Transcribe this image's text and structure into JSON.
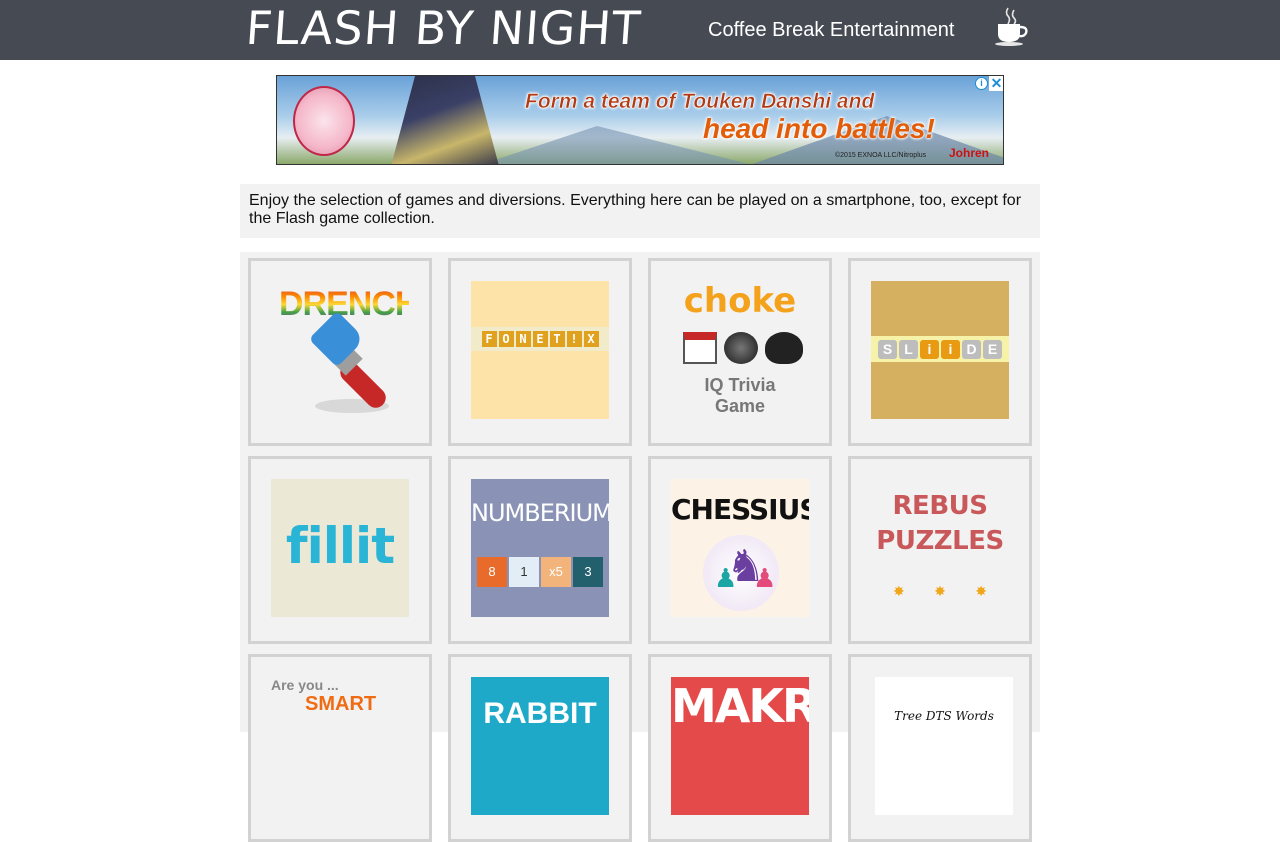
{
  "header": {
    "logo": "FLASH BY NIGHT",
    "tagline": "Coffee Break Entertainment",
    "cup_icon": "coffee-cup-icon"
  },
  "ad": {
    "line1": "Form a team of Touken Danshi and",
    "line2": "head into battles!",
    "copyright": "©2015 EXNOA LLC/Nitroplus",
    "brand": "Johren",
    "info_icon": "ad-info-icon",
    "close_icon": "ad-close-icon",
    "info_glyph": "i",
    "close_glyph": "✕"
  },
  "intro": {
    "text": "Enjoy the selection of games and diversions. Everything here can be played on a smartphone, too, except for the Flash game collection."
  },
  "games": {
    "drench": {
      "title": "DRENCH"
    },
    "fonetix": {
      "letters": [
        "F",
        "O",
        "N",
        "E",
        "T",
        "!",
        "X"
      ]
    },
    "choke": {
      "title": "choke",
      "sub1": "IQ Trivia",
      "sub2": "Game"
    },
    "slide": {
      "letters": [
        "S",
        "L",
        "i",
        "i",
        "D",
        "E"
      ]
    },
    "fillit": {
      "title": "fillit"
    },
    "numberium": {
      "title": "NUMBERIUM",
      "cells": [
        {
          "v": "8",
          "c": "#e96b2b"
        },
        {
          "v": "1",
          "c": "#e3edf5"
        },
        {
          "v": "x5",
          "c": "#f3b47c"
        },
        {
          "v": "3",
          "c": "#23606e"
        }
      ]
    },
    "chessius": {
      "title": "CHESSIUS"
    },
    "rebus": {
      "line1": "REBUS",
      "line2": "PUZZLES",
      "star": "✸"
    },
    "areyou": {
      "line1": "Are you ...",
      "line2": "SMART"
    },
    "rabbit": {
      "title": "RABBIT"
    },
    "makr": {
      "title": "MAKR"
    },
    "treeword": {
      "title": "Tree DTS Words"
    }
  }
}
